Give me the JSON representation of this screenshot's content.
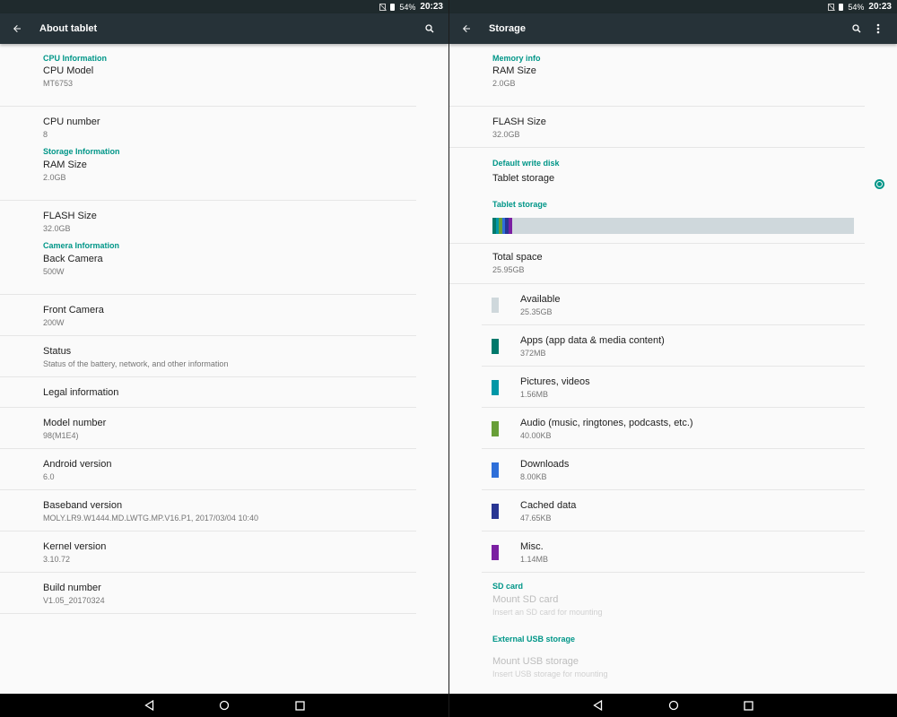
{
  "colors": {
    "accent": "#009688",
    "toolbar": "#263238",
    "statusbar": "#1f2a2d"
  },
  "left": {
    "status": {
      "battery": "54%",
      "time": "20:23"
    },
    "toolbar": {
      "title": "About tablet",
      "back_icon": "arrow-left-icon",
      "search_icon": "search-icon"
    },
    "sections": [
      {
        "header": "CPU Information",
        "items": [
          {
            "title": "CPU Model",
            "subtitle": "MT6753"
          },
          {
            "title": "CPU number",
            "subtitle": "8"
          }
        ]
      },
      {
        "header": "Storage Information",
        "items": [
          {
            "title": "RAM Size",
            "subtitle": "2.0GB"
          },
          {
            "title": "FLASH Size",
            "subtitle": "32.0GB"
          }
        ]
      },
      {
        "header": "Camera Information",
        "items": [
          {
            "title": "Back Camera",
            "subtitle": "500W"
          },
          {
            "title": "Front Camera",
            "subtitle": "200W"
          },
          {
            "title": "Status",
            "subtitle": "Status of the battery, network, and other information"
          },
          {
            "title": "Legal information",
            "subtitle": ""
          },
          {
            "title": "Model number",
            "subtitle": "98(M1E4)"
          },
          {
            "title": "Android version",
            "subtitle": "6.0"
          },
          {
            "title": "Baseband version",
            "subtitle": "MOLY.LR9.W1444.MD.LWTG.MP.V16.P1, 2017/03/04 10:40"
          },
          {
            "title": "Kernel version",
            "subtitle": "3.10.72"
          },
          {
            "title": "Build number",
            "subtitle": "V1.05_20170324"
          }
        ]
      }
    ]
  },
  "right": {
    "status": {
      "battery": "54%",
      "time": "20:23"
    },
    "toolbar": {
      "title": "Storage",
      "back_icon": "arrow-left-icon",
      "search_icon": "search-icon",
      "more_icon": "more-vert-icon"
    },
    "memory_header": "Memory info",
    "memory_items": [
      {
        "title": "RAM Size",
        "subtitle": "2.0GB"
      },
      {
        "title": "FLASH Size",
        "subtitle": "32.0GB"
      }
    ],
    "default_write_header": "Default write disk",
    "default_write_option": {
      "label": "Tablet storage",
      "selected": true
    },
    "tablet_storage_header": "Tablet storage",
    "total": {
      "title": "Total space",
      "subtitle": "25.95GB"
    },
    "categories": [
      {
        "title": "Available",
        "subtitle": "25.35GB",
        "color": "#cfd8dc"
      },
      {
        "title": "Apps (app data & media content)",
        "subtitle": "372MB",
        "color": "#00796b"
      },
      {
        "title": "Pictures, videos",
        "subtitle": "1.56MB",
        "color": "#0097a7"
      },
      {
        "title": "Audio (music, ringtones, podcasts, etc.)",
        "subtitle": "40.00KB",
        "color": "#689f38"
      },
      {
        "title": "Downloads",
        "subtitle": "8.00KB",
        "color": "#2e6fd9"
      },
      {
        "title": "Cached data",
        "subtitle": "47.65KB",
        "color": "#283593"
      },
      {
        "title": "Misc.",
        "subtitle": "1.14MB",
        "color": "#7b1fa2"
      }
    ],
    "sd_header": "SD card",
    "sd_item": {
      "title": "Mount SD card",
      "subtitle": "Insert an SD card for mounting"
    },
    "usb_header": "External USB storage",
    "usb_item": {
      "title": "Mount USB storage",
      "subtitle": "Insert USB storage for mounting"
    }
  },
  "navbar": {
    "back_icon": "nav-back-icon",
    "home_icon": "nav-home-icon",
    "recents_icon": "nav-recents-icon"
  }
}
